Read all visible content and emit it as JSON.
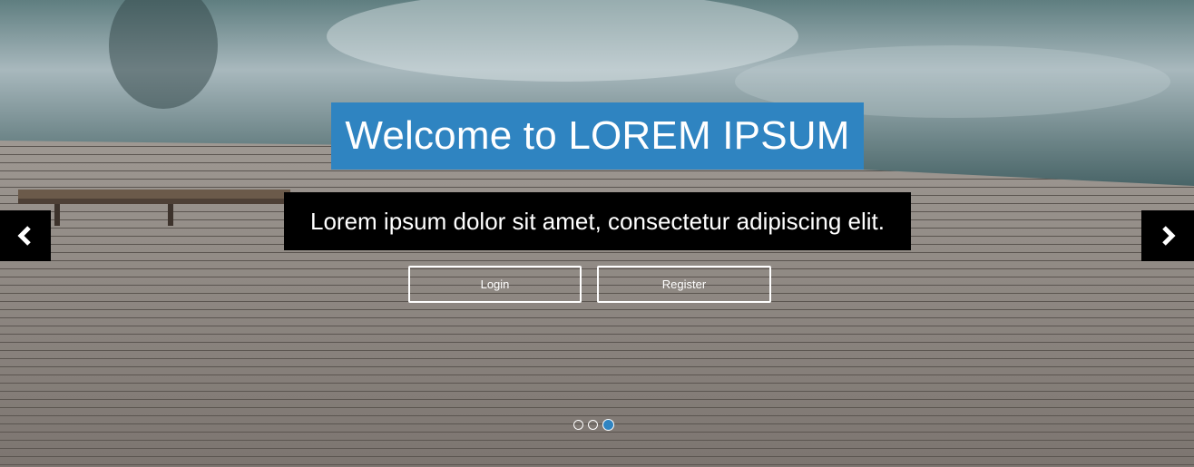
{
  "hero": {
    "title": "Welcome to LOREM IPSUM",
    "subtitle": "Lorem ipsum dolor sit amet, consectetur adipiscing elit.",
    "buttons": {
      "login": "Login",
      "register": "Register"
    },
    "slides": {
      "count": 3,
      "active_index": 3
    },
    "colors": {
      "accent": "#2f84c1",
      "caption_bg": "#000000",
      "text": "#ffffff"
    },
    "icons": {
      "prev": "chevron-left-icon",
      "next": "chevron-right-icon"
    }
  }
}
